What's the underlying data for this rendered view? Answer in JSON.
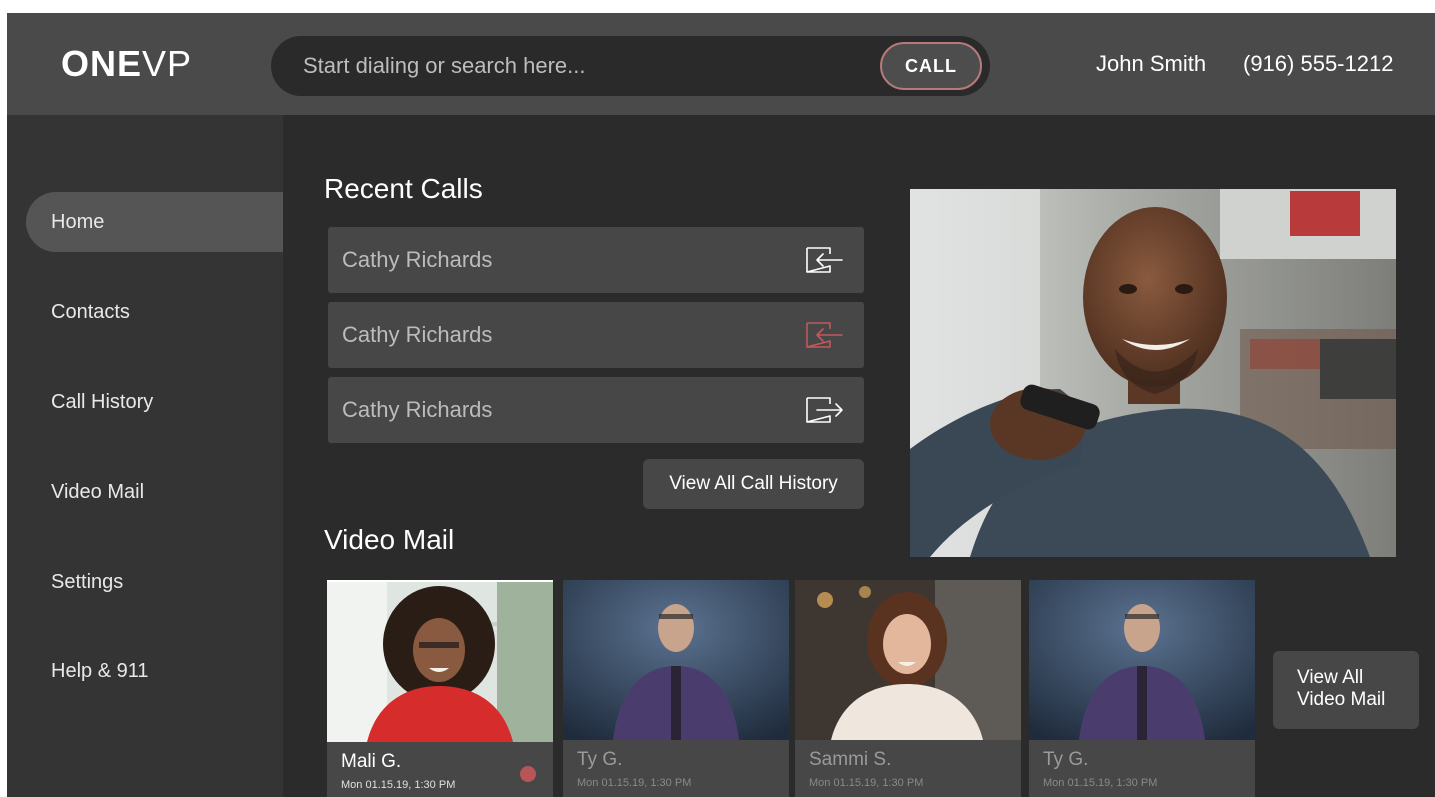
{
  "app": {
    "logo_bold": "ONE",
    "logo_light": "VP"
  },
  "header": {
    "search_placeholder": "Start dialing or search here...",
    "call_label": "CALL",
    "user_name": "John Smith",
    "user_phone": "(916) 555-1212"
  },
  "sidebar": {
    "items": [
      {
        "label": "Home",
        "active": true
      },
      {
        "label": "Contacts"
      },
      {
        "label": "Call History"
      },
      {
        "label": "Video Mail"
      },
      {
        "label": "Settings"
      },
      {
        "label": "Help & 911"
      }
    ]
  },
  "recent_calls": {
    "title": "Recent Calls",
    "items": [
      {
        "name": "Cathy Richards",
        "icon": "incoming-call-icon",
        "color": "#ffffff"
      },
      {
        "name": "Cathy Richards",
        "icon": "missed-call-icon",
        "color": "#c2585b"
      },
      {
        "name": "Cathy Richards",
        "icon": "outgoing-call-icon",
        "color": "#ffffff"
      }
    ],
    "view_all_label": "View All Call History"
  },
  "video_mail": {
    "title": "Video Mail",
    "items": [
      {
        "name": "Mali G.",
        "date": "Mon 01.15.19, 1:30 PM",
        "unread": true
      },
      {
        "name": "Ty G.",
        "date": "Mon 01.15.19, 1:30 PM",
        "unread": false
      },
      {
        "name": "Sammi S.",
        "date": "Mon 01.15.19, 1:30 PM",
        "unread": false
      },
      {
        "name": "Ty G.",
        "date": "Mon 01.15.19, 1:30 PM",
        "unread": false
      }
    ],
    "view_all_line1": "View All",
    "view_all_line2": "Video Mail"
  },
  "colors": {
    "accent_missed": "#c2585b",
    "unread_dot": "#b85557",
    "background": "#2b2b2b",
    "header": "#4a4a4a"
  }
}
